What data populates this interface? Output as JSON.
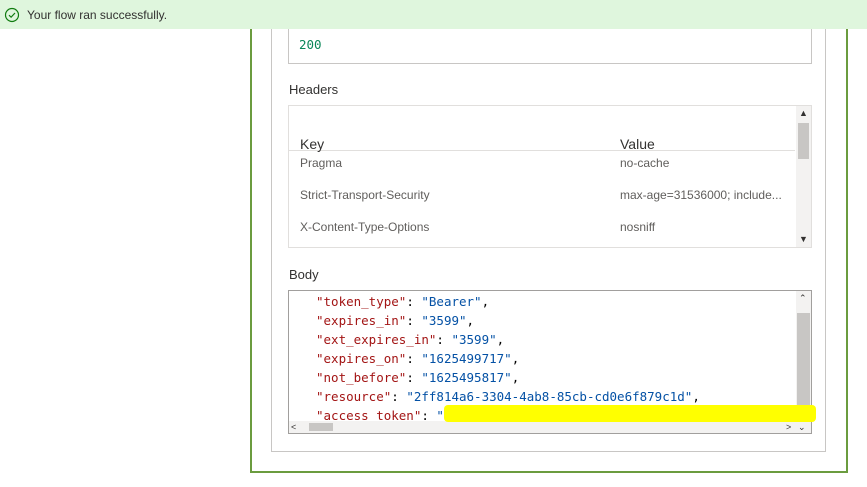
{
  "banner": {
    "message": "Your flow ran successfully.",
    "icon": "check-circle-icon",
    "color": "#dff6dd"
  },
  "status_code": {
    "value": "200"
  },
  "headers": {
    "title": "Headers",
    "col_key": "Key",
    "col_value": "Value",
    "rows": [
      {
        "key": "Pragma",
        "value": "no-cache"
      },
      {
        "key": "Strict-Transport-Security",
        "value": "max-age=31536000; include..."
      },
      {
        "key": "X-Content-Type-Options",
        "value": "nosniff"
      }
    ]
  },
  "body": {
    "title": "Body",
    "lines": [
      {
        "key": "\"token_type\"",
        "sep": ": ",
        "val": "\"Bearer\"",
        "end": ","
      },
      {
        "key": "\"expires_in\"",
        "sep": ": ",
        "val": "\"3599\"",
        "end": ","
      },
      {
        "key": "\"ext_expires_in\"",
        "sep": ": ",
        "val": "\"3599\"",
        "end": ","
      },
      {
        "key": "\"expires_on\"",
        "sep": ": ",
        "val": "\"1625499717\"",
        "end": ","
      },
      {
        "key": "\"not_before\"",
        "sep": ": ",
        "val": "\"1625495817\"",
        "end": ","
      },
      {
        "key": "\"resource\"",
        "sep": ": ",
        "val": "\"2ff814a6-3304-4ab8-85cb-cd0e6f879c1d\"",
        "end": ","
      },
      {
        "key": "\"access_token\"",
        "sep": ": ",
        "val": "\"",
        "end": ""
      }
    ]
  },
  "colors": {
    "accent_border": "#6b9c3f",
    "json_key": "#a31515",
    "json_string": "#0451a5",
    "status_number": "#098658"
  }
}
